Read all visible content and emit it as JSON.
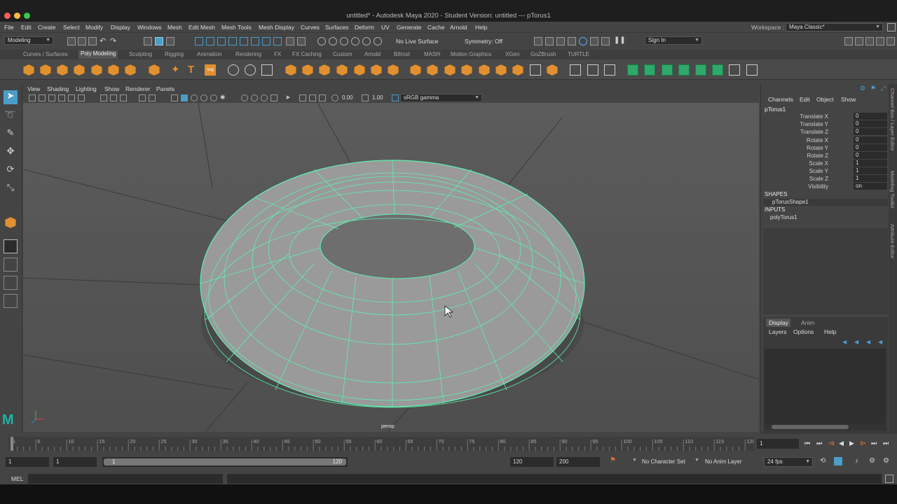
{
  "window": {
    "title": "untitled* - Autodesk Maya 2020 - Student Version: untitled   ---   pTorus1"
  },
  "menu": [
    "File",
    "Edit",
    "Create",
    "Select",
    "Modify",
    "Display",
    "Windows",
    "Mesh",
    "Edit Mesh",
    "Mesh Tools",
    "Mesh Display",
    "Curves",
    "Surfaces",
    "Deform",
    "UV",
    "Generate",
    "Cache",
    "Arnold",
    "Help"
  ],
  "workspace": {
    "label": "Workspace :",
    "value": "Maya Classic*"
  },
  "status_line": {
    "mode": "Modeling",
    "live_surface": "No Live Surface",
    "symmetry": "Symmetry: Off",
    "sign_in": "Sign In"
  },
  "shelf_tabs": [
    "Curves / Surfaces",
    "Poly Modeling",
    "Sculpting",
    "Rigging",
    "Animation",
    "Rendering",
    "FX",
    "FX Caching",
    "Custom",
    "Arnold",
    "Bifrost",
    "MASH",
    "Motion Graphics",
    "XGen",
    "GoZBrush",
    "TURTLE"
  ],
  "active_shelf_tab": "Poly Modeling",
  "viewport": {
    "menus": [
      "View",
      "Shading",
      "Lighting",
      "Show",
      "Renderer",
      "Panels"
    ],
    "exposure": "0.00",
    "gamma": "1.00",
    "color_space": "sRGB gamma",
    "camera_label": "persp"
  },
  "channel_box": {
    "menus": [
      "Channels",
      "Edit",
      "Object",
      "Show"
    ],
    "object": "pTorus1",
    "attributes": [
      {
        "name": "Translate X",
        "value": "0"
      },
      {
        "name": "Translate Y",
        "value": "0"
      },
      {
        "name": "Translate Z",
        "value": "0"
      },
      {
        "name": "Rotate X",
        "value": "0"
      },
      {
        "name": "Rotate Y",
        "value": "0"
      },
      {
        "name": "Rotate Z",
        "value": "0"
      },
      {
        "name": "Scale X",
        "value": "1"
      },
      {
        "name": "Scale Y",
        "value": "1"
      },
      {
        "name": "Scale Z",
        "value": "1"
      },
      {
        "name": "Visibility",
        "value": "on"
      }
    ],
    "shapes_label": "SHAPES",
    "shape_node": "pTorusShape1",
    "inputs_label": "INPUTS",
    "input_node": "polyTorus1"
  },
  "layer_editor": {
    "tabs": [
      "Display",
      "Anim"
    ],
    "menus": [
      "Layers",
      "Options",
      "Help"
    ]
  },
  "side_tabs": [
    "Channel Box / Layer Editor",
    "Modeling Toolkit",
    "Attribute Editor"
  ],
  "time_slider": {
    "ticks": [
      "1",
      "5",
      "10",
      "15",
      "20",
      "25",
      "30",
      "35",
      "40",
      "45",
      "50",
      "55",
      "60",
      "65",
      "70",
      "75",
      "80",
      "85",
      "90",
      "95",
      "100",
      "105",
      "110",
      "115",
      "120"
    ],
    "current_frame": "1"
  },
  "range": {
    "start": "1",
    "playback_start": "1",
    "slider_start": "1",
    "slider_end": "120",
    "playback_end": "120",
    "end": "200",
    "character_set": "No Character Set",
    "anim_layer": "No Anim Layer",
    "fps": "24 fps"
  },
  "command_line": {
    "label": "MEL"
  },
  "colors": {
    "wireframe": "#5ef0b0",
    "accent": "#4a9ec8",
    "background": "#444444"
  }
}
